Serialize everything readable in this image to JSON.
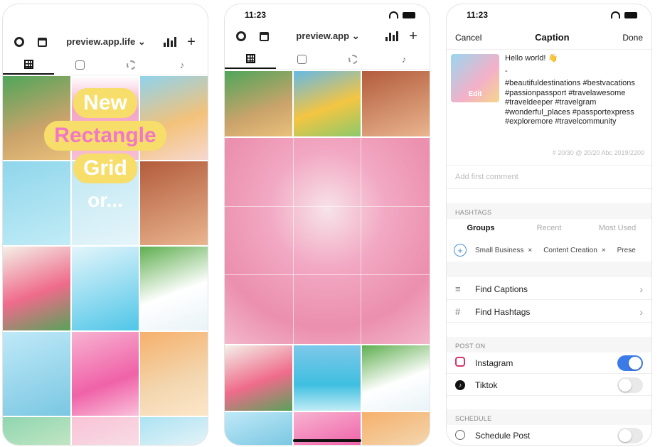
{
  "phone1": {
    "title": "preview.app.life",
    "title_arrow": "⌄",
    "plus": "+",
    "tiktok": "♪",
    "promo": {
      "line1": "New",
      "line2": "Rectangle",
      "line3": "Grid",
      "line4": "or..."
    }
  },
  "phone2": {
    "time": "11:23",
    "title": "preview.app",
    "title_arrow": "⌄",
    "plus": "+",
    "tiktok": "♪"
  },
  "phone3": {
    "time": "11:23",
    "nav": {
      "cancel": "Cancel",
      "title": "Caption",
      "done": "Done"
    },
    "thumb_label": "Edit",
    "caption_lines": [
      "Hello world! 👋",
      "-",
      "#beautifuldestinations #bestvacations",
      "#passionpassport #travelawesome",
      "#traveldeeper #travelgram",
      "#wonderful_places #passportexpress",
      "#exploremore #travelcommunity"
    ],
    "counts": "# 20/30   @ 20/20   Abc 2019/2200",
    "comment_placeholder": "Add first comment",
    "hashtags_header": "HASHTAGS",
    "segments": [
      "Groups",
      "Recent",
      "Most Used"
    ],
    "chips": [
      "Small Business",
      "Content Creation",
      "Prese"
    ],
    "chip_close": "×",
    "chip_plus": "+",
    "find_captions": "Find Captions",
    "find_hashtags": "Find Hashtags",
    "chevron": "›",
    "hash_glyph": "#",
    "list_glyph": "≡",
    "post_on_header": "POST ON",
    "instagram": "Instagram",
    "tiktok": "Tiktok",
    "tiktok_glyph": "♪",
    "schedule_header": "SCHEDULE",
    "schedule_post": "Schedule Post"
  },
  "colors": {
    "accent": "#3b7be8",
    "promo_yellow": "#f7dd6a",
    "promo_pink": "#f277c6"
  },
  "icons": [
    "gear-icon",
    "calendar-icon",
    "chevron-down-icon",
    "bar-chart-icon",
    "plus-icon",
    "grid-icon",
    "reels-icon",
    "story-ring-icon",
    "tiktok-icon",
    "wifi-icon",
    "battery-icon",
    "list-icon",
    "hashtag-icon",
    "instagram-icon",
    "clock-icon",
    "chevron-right-icon"
  ]
}
